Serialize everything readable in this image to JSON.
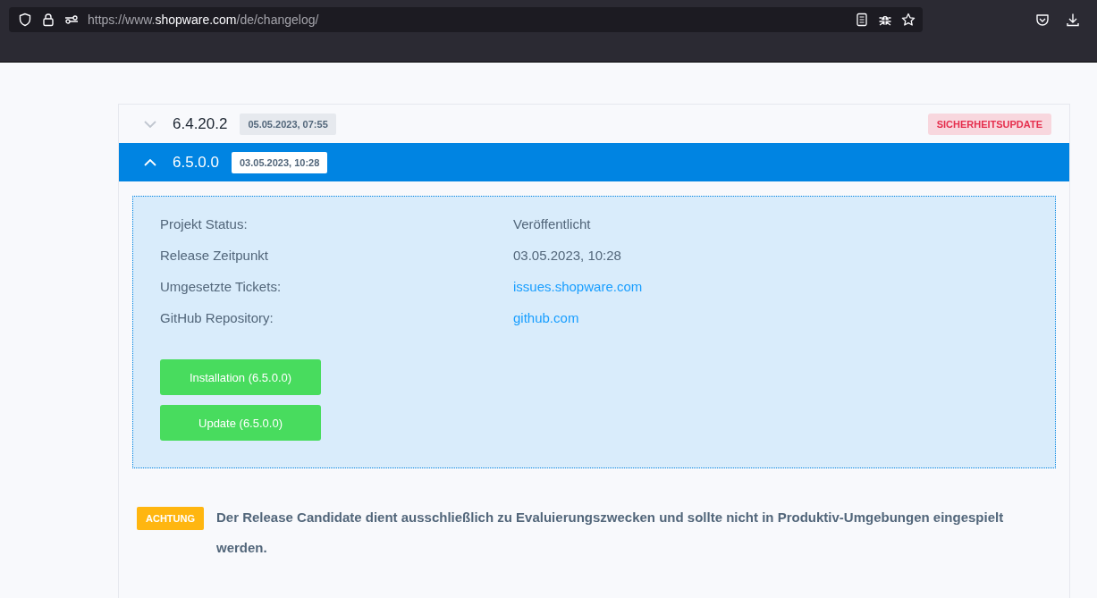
{
  "browser": {
    "url": {
      "prefix": "https://www.",
      "domain": "shopware.com",
      "path": "/de/changelog/"
    }
  },
  "releases": [
    {
      "version": "6.4.20.2",
      "date": "05.05.2023, 07:55",
      "expanded": false,
      "badge": "SICHERHEITSUPDATE"
    },
    {
      "version": "6.5.0.0",
      "date": "03.05.2023, 10:28",
      "expanded": true,
      "details": [
        {
          "label": "Projekt Status:",
          "value": "Veröffentlicht",
          "kind": "text"
        },
        {
          "label": "Release Zeitpunkt",
          "value": "03.05.2023, 10:28",
          "kind": "text"
        },
        {
          "label": "Umgesetzte Tickets:",
          "value": "issues.shopware.com",
          "kind": "link"
        },
        {
          "label": "GitHub Repository:",
          "value": "github.com",
          "kind": "link"
        }
      ],
      "buttons": [
        "Installation (6.5.0.0)",
        "Update (6.5.0.0)"
      ]
    }
  ],
  "notice": {
    "badge": "ACHTUNG",
    "text": "Der Release Candidate dient ausschließlich zu Evaluierungszwecken und sollte nicht in Produktiv-Umgebungen eingespielt werden."
  }
}
